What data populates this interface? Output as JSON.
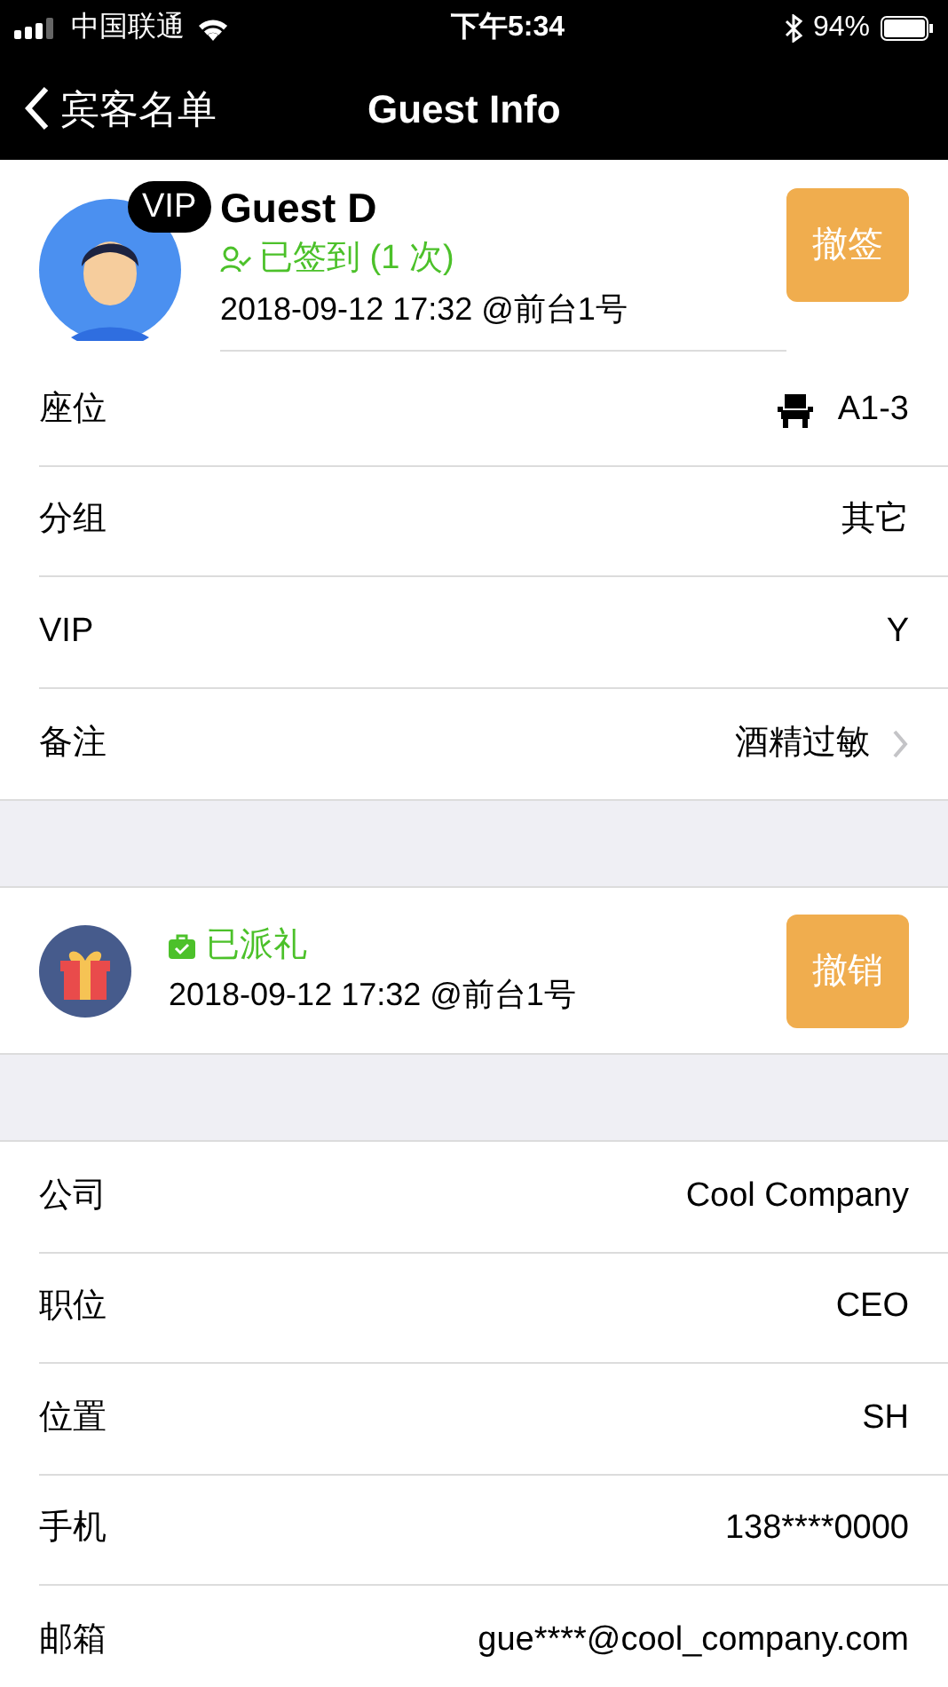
{
  "status_bar": {
    "carrier": "中国联通",
    "time": "下午5:34",
    "battery": "94%"
  },
  "nav": {
    "back": "宾客名单",
    "title": "Guest Info"
  },
  "guest": {
    "badge": "VIP",
    "name": "Guest D",
    "status": "已签到 (1 次)",
    "time": "2018-09-12 17:32 @前台1号",
    "button": "撤签"
  },
  "info_rows": [
    {
      "label": "座位",
      "value": "A1-3",
      "kind": "seat"
    },
    {
      "label": "分组",
      "value": "其它",
      "kind": "plain"
    },
    {
      "label": "VIP",
      "value": "Y",
      "kind": "plain"
    },
    {
      "label": "备注",
      "value": "酒精过敏",
      "kind": "link"
    }
  ],
  "gift": {
    "status": "已派礼",
    "time": "2018-09-12 17:32 @前台1号",
    "button": "撤销"
  },
  "contact_rows": [
    {
      "label": "公司",
      "value": "Cool Company"
    },
    {
      "label": "职位",
      "value": "CEO"
    },
    {
      "label": "位置",
      "value": "SH"
    },
    {
      "label": "手机",
      "value": "138****0000"
    },
    {
      "label": "邮箱",
      "value": "gue****@cool_company.com"
    }
  ]
}
